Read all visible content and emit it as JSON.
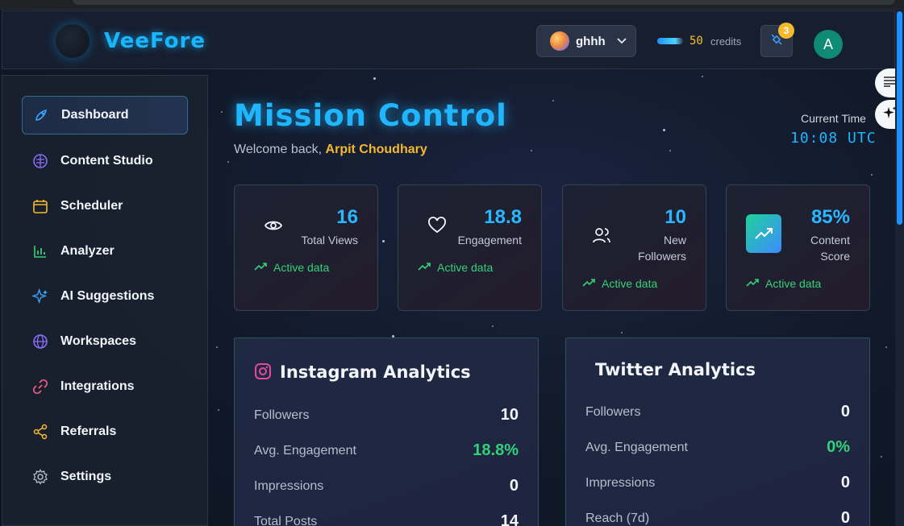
{
  "app": {
    "name": "VeeFore"
  },
  "header": {
    "workspace_name": "ghhh",
    "credits_value": "50",
    "credits_label": "credits",
    "notification_count": "3",
    "user_initial": "A"
  },
  "sidebar": {
    "items": [
      {
        "label": "Dashboard",
        "icon": "rocket-icon",
        "active": true
      },
      {
        "label": "Content Studio",
        "icon": "brain-icon"
      },
      {
        "label": "Scheduler",
        "icon": "calendar-icon"
      },
      {
        "label": "Analyzer",
        "icon": "bar-chart-icon"
      },
      {
        "label": "AI Suggestions",
        "icon": "sparkles-icon"
      },
      {
        "label": "Workspaces",
        "icon": "globe-icon"
      },
      {
        "label": "Integrations",
        "icon": "link-icon"
      },
      {
        "label": "Referrals",
        "icon": "share-icon"
      },
      {
        "label": "Settings",
        "icon": "gear-icon"
      }
    ]
  },
  "main": {
    "title": "Mission Control",
    "welcome_prefix": "Welcome back,",
    "user_name": "Arpit Choudhary",
    "time_label": "Current Time",
    "time_value": "10:08 UTC"
  },
  "stats": [
    {
      "value": "16",
      "label": "Total Views",
      "icon": "eye-icon",
      "status": "Active data"
    },
    {
      "value": "18.8",
      "label": "Engagement",
      "icon": "heart-icon",
      "status": "Active data"
    },
    {
      "value": "10",
      "label_line1": "New",
      "label_line2": "Followers",
      "icon": "users-icon",
      "status": "Active data"
    },
    {
      "value": "85%",
      "label_line1": "Content",
      "label_line2": "Score",
      "icon": "trending-up-icon",
      "status": "Active data"
    }
  ],
  "instagram": {
    "title": "Instagram Analytics",
    "rows": [
      {
        "label": "Followers",
        "value": "10"
      },
      {
        "label": "Avg. Engagement",
        "value": "18.8%"
      },
      {
        "label": "Impressions",
        "value": "0"
      },
      {
        "label": "Total Posts",
        "value": "14"
      }
    ]
  },
  "twitter": {
    "title": "Twitter Analytics",
    "rows": [
      {
        "label": "Followers",
        "value": "0"
      },
      {
        "label": "Avg. Engagement",
        "value": "0%"
      },
      {
        "label": "Impressions",
        "value": "0"
      },
      {
        "label": "Reach (7d)",
        "value": "0"
      }
    ]
  },
  "colors": {
    "accent": "#1fb6ff",
    "positive": "#33d17a",
    "highlight": "#f5b92e"
  }
}
